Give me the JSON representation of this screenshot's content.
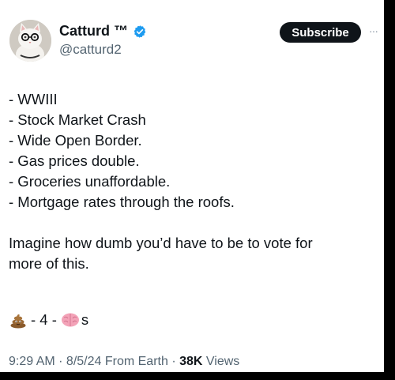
{
  "author": {
    "name": "Catturd ™",
    "handle": "@catturd2",
    "verified": true
  },
  "subscribe_label": "Subscribe",
  "more_label": "···",
  "tweet": {
    "lines": [
      "- WWIII",
      "- Stock Market Crash",
      "- Wide Open Border.",
      "- Gas prices double.",
      "- Groceries unaffordable.",
      "- Mortgage rates through the roofs."
    ],
    "paragraph": [
      "Imagine how dumb you’d have to be to vote for",
      "more of this."
    ],
    "emoji_line": {
      "emoji1": "poop-emoji",
      "middle": "- 4 -",
      "emoji2": "brain-emoji",
      "suffix": "s"
    }
  },
  "meta": {
    "time": "9:29 AM",
    "sep1": " · ",
    "date": "8/5/24 From Earth",
    "sep2": " · ",
    "views_count": "38K",
    "views_label": " Views"
  },
  "colors": {
    "accent": "#1d9bf0",
    "text": "#0f1419",
    "secondary": "#536471"
  }
}
